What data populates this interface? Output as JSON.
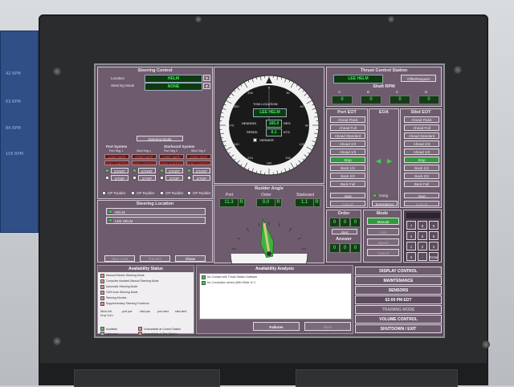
{
  "side_panel": {
    "labels": [
      "42 RPM",
      "63 RPM",
      "84 RPM",
      "105 RPM"
    ]
  },
  "steering_control": {
    "title": "Steering Control",
    "location_label": "Location",
    "location_value": "HELM",
    "mode_label": "Steering Mode",
    "mode_value": "NONE",
    "mode_button": "Steering Mode",
    "port_system": "Port System",
    "stbd_system": "Starboard System",
    "pump_labels": [
      "Port Strg 1",
      "Stbd Strg 1",
      "Port Strg 2",
      "Stbd Strg 2"
    ],
    "alarm_text": "CONT. SUPP. OFF",
    "alarm_text2": "STRG CONTROL",
    "start": "START",
    "stop": "STOP",
    "op_rudder": "OP Rudder"
  },
  "steering_location": {
    "title": "Steering Location",
    "items": [
      "HELM",
      "LEE HELM"
    ],
    "buttons": [
      "Take Lead",
      "Transfer",
      "Close"
    ]
  },
  "compass": {
    "location_label": "TOW LOCATION",
    "location_value": "LEE HELM",
    "heading_label": "HEADING",
    "heading_value": "165.0",
    "heading_unit": "DEG",
    "speed_label": "SPEED",
    "speed_value": "0.1",
    "speed_unit": "KTS",
    "vernier": "VERNIER",
    "ring_labels": [
      "0",
      "30",
      "60",
      "90",
      "120",
      "150",
      "180",
      "210",
      "240",
      "270",
      "300",
      "330"
    ]
  },
  "rudder_angle": {
    "title": "Rudder Angle",
    "port_label": "Port",
    "order_label": "Order",
    "stbd_label": "Starboard",
    "port_value": "11.3",
    "order_value": "0.0",
    "stbd_value": "1.1",
    "port_suffix": "R",
    "stbd_suffix": "R",
    "order_suffix": "R",
    "scale_left": "35",
    "scale_right": "35"
  },
  "thrust_control": {
    "title": "Thrust Control Station",
    "station_value": "LEE HELM",
    "offer_button": "Offer/Request",
    "shaft_rpm": "Shaft RPM",
    "rpm_labels": [
      "A",
      "B",
      "C",
      "D"
    ],
    "rpm_values": [
      "0",
      "0",
      "0",
      "0"
    ]
  },
  "port_eot": {
    "title": "Port EOT",
    "items": [
      "Ahead Flank",
      "Ahead Full",
      "Ahead Standard",
      "Ahead 2/3",
      "Ahead 1/3",
      "Stop",
      "Back 1/3",
      "Back 2/3",
      "Back Full"
    ],
    "selected": 5,
    "alert": "Alert",
    "cancel": "Cancel"
  },
  "eoa": {
    "title": "EOA",
    "gang": "Gang",
    "emergency": "Emergency"
  },
  "stbd_eot": {
    "title": "Stbd EOT",
    "items": [
      "Ahead Flank",
      "Ahead Full",
      "Ahead Standard",
      "Ahead 2/3",
      "Ahead 1/3",
      "Stop",
      "Back 1/3",
      "Back 2/3",
      "Back Full"
    ],
    "selected": 5,
    "alert": "Alert",
    "cancel": "Cancel"
  },
  "order_answer": {
    "order_label": "Order",
    "order_values": [
      "0",
      "0",
      "0"
    ],
    "alert": "Alert",
    "answer_label": "Answer",
    "answer_values": [
      "0",
      "0",
      "0"
    ]
  },
  "mode": {
    "title": "Mode",
    "items": [
      "Manual",
      "Auto",
      "Speed",
      "Cancel"
    ],
    "selected": 0
  },
  "keypad": {
    "keys": [
      "7",
      "8",
      "9",
      "4",
      "5",
      "6",
      "1",
      "2",
      "3",
      "0",
      "-",
      "Enter"
    ]
  },
  "availability_status": {
    "title": "Availability Status",
    "items": [
      "Manual Electric Steering Mode",
      "Computer Assisted Manual Steering Mode",
      "Automatic Steering Mode",
      "CMS Auto Steering Mode",
      "Steering Monitor",
      "Supplementary Steering Functions"
    ],
    "row_labels": [
      "Wind Infl.",
      "Drop Turn"
    ],
    "small_labels": [
      "port pwr",
      "stbd pwr",
      "port alert",
      "stbd alert"
    ],
    "legend": [
      "Available",
      "Unavailable at Control Station",
      "Unknown",
      "Unavailable at This Station"
    ]
  },
  "availability_analysis": {
    "title": "Availability Analysis",
    "items": [
      "No Contact with Thrust Station Software",
      "No Connection drives (With Either IV C"
    ],
    "failures": "Failures",
    "more": "More"
  },
  "menu": {
    "items": [
      "DISPLAY CONTROL",
      "MAINTENANCE",
      "SENSORS",
      "02:09 PM EDT",
      "TRAINING MODE",
      "VOLUME CONTROL",
      "SHUTDOWN / EXIT"
    ]
  },
  "colors": {
    "panel": "#6e5c6e",
    "green": "#3df05c",
    "selected": "#2f9b3a",
    "background": "#5a4b5c"
  }
}
